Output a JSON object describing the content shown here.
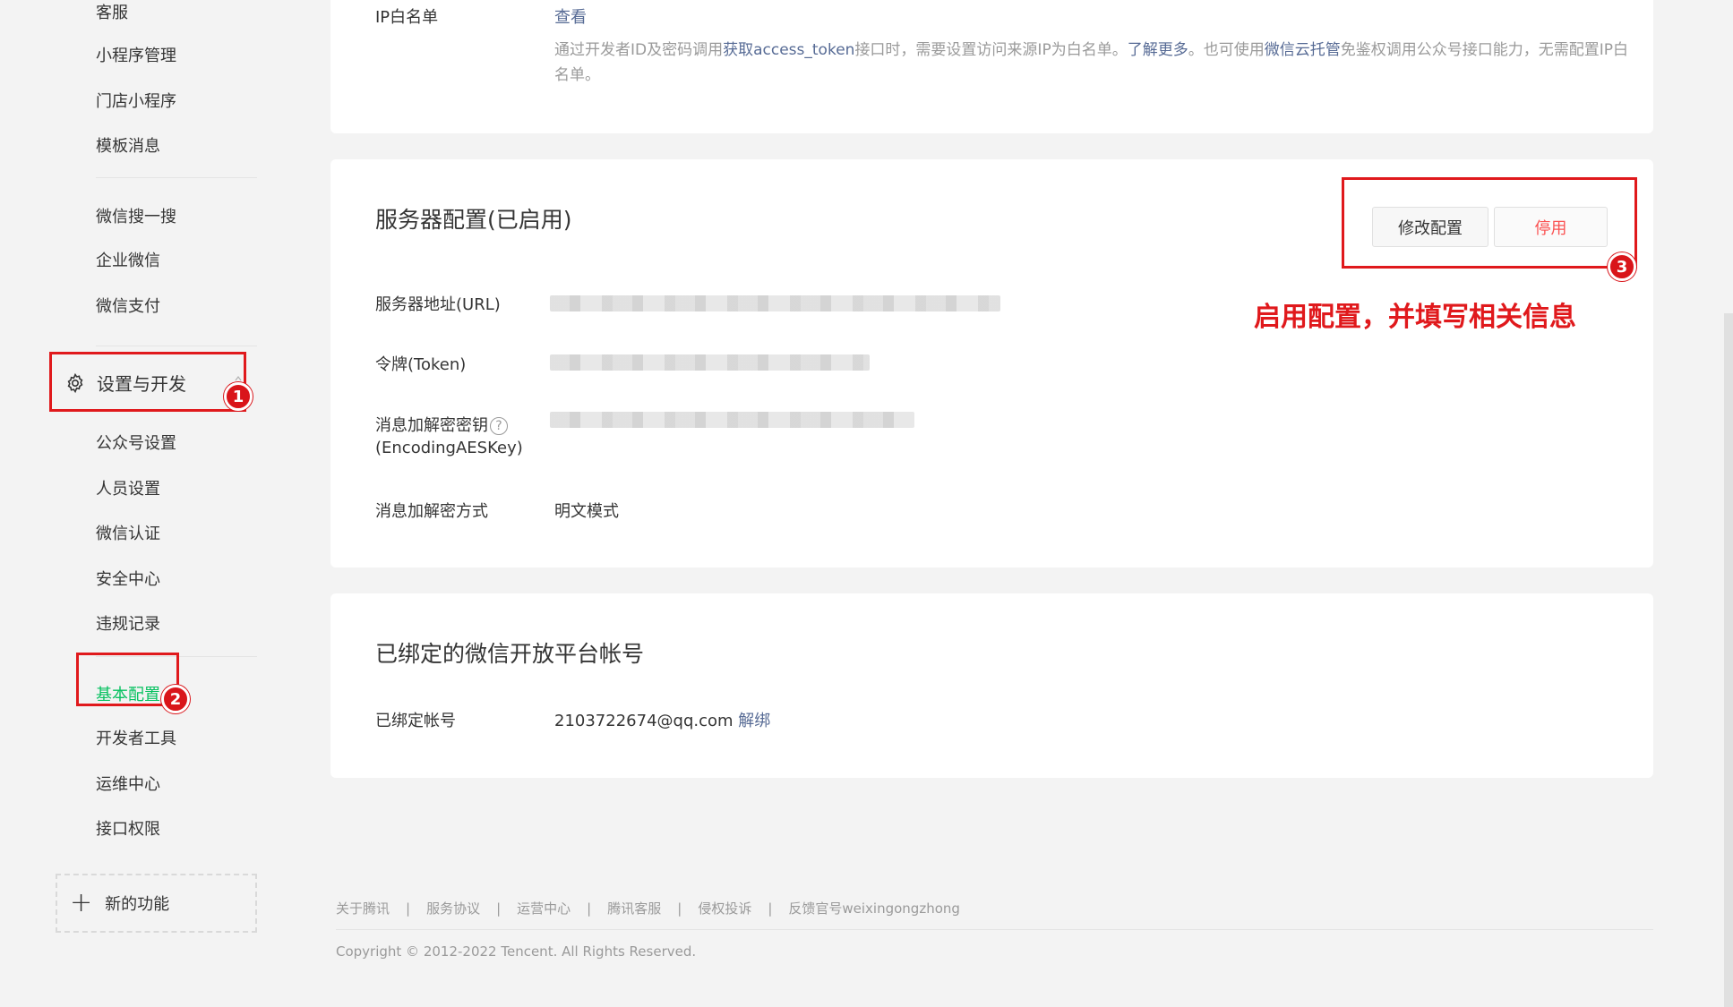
{
  "sidebar": {
    "items_top": [
      "客服",
      "小程序管理",
      "门店小程序",
      "模板消息"
    ],
    "items_mid": [
      "微信搜一搜",
      "企业微信",
      "微信支付"
    ],
    "section_label": "设置与开发",
    "items_settings": [
      "公众号设置",
      "人员设置",
      "微信认证",
      "安全中心",
      "违规记录"
    ],
    "items_dev": [
      "基本配置",
      "开发者工具",
      "运维中心",
      "接口权限"
    ],
    "active_item": "基本配置",
    "new_feature_label": "新的功能"
  },
  "annotations": {
    "badge1": "1",
    "badge2": "2",
    "badge3": "3",
    "note": "启用配置，并填写相关信息",
    "color": "#e0191c"
  },
  "ip_whitelist": {
    "label": "IP白名单",
    "link": "查看",
    "desc_part1": "通过开发者ID及密码调用",
    "desc_link1": "获取access_token",
    "desc_part2": "接口时，需要设置访问来源IP为白名单。",
    "desc_link2": "了解更多",
    "desc_part3": "。也可使用",
    "desc_link3": "微信云托管",
    "desc_part4": "免鉴权调用公众号接口能力，无需配置IP白名单。"
  },
  "server_config": {
    "title": "服务器配置(已启用)",
    "modify_button": "修改配置",
    "stop_button": "停用",
    "url_label": "服务器地址(URL)",
    "token_label": "令牌(Token)",
    "aes_label_line1": "消息加解密密钥",
    "aes_help": "?",
    "aes_label_line2": "(EncodingAESKey)",
    "mode_label": "消息加解密方式",
    "mode_value": "明文模式"
  },
  "open_platform": {
    "title": "已绑定的微信开放平台帐号",
    "account_label": "已绑定帐号",
    "account_value": "2103722674@qq.com",
    "unbind_link": "解绑"
  },
  "footer": {
    "links": [
      "关于腾讯",
      "服务协议",
      "运营中心",
      "腾讯客服",
      "侵权投诉",
      "反馈官号weixingongzhong"
    ],
    "copyright": "Copyright © 2012-2022 Tencent. All Rights Reserved."
  },
  "colors": {
    "accent_green": "#07c160",
    "link_blue": "#576b95",
    "danger_red": "#fa5151"
  }
}
